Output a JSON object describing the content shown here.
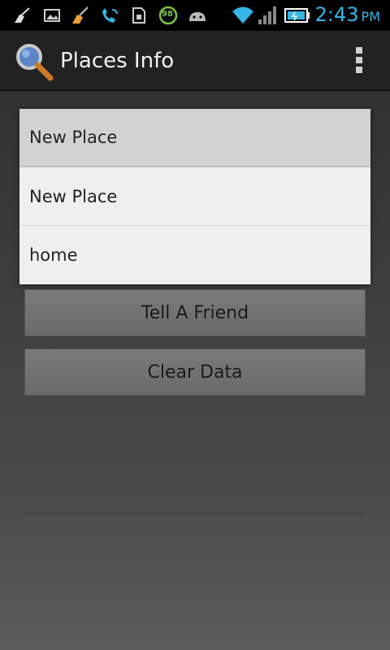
{
  "status_bar": {
    "time": "2:43",
    "ampm": "PM",
    "battery_badge": "98",
    "icons": [
      "broom-icon",
      "image-icon",
      "broom-icon",
      "wifi-call-icon",
      "sim-icon",
      "battery-saver-icon",
      "android-icon",
      "wifi-icon",
      "signal-icon",
      "battery-icon"
    ]
  },
  "action_bar": {
    "title": "Places Info",
    "app_icon": "magnifier-icon",
    "menu_icon": "overflow-menu-icon"
  },
  "spinner": {
    "selected_value": "New Place",
    "options": [
      "New Place",
      "home"
    ]
  },
  "buttons": {
    "tell_friend": "Tell A Friend",
    "clear_data": "Clear Data"
  }
}
